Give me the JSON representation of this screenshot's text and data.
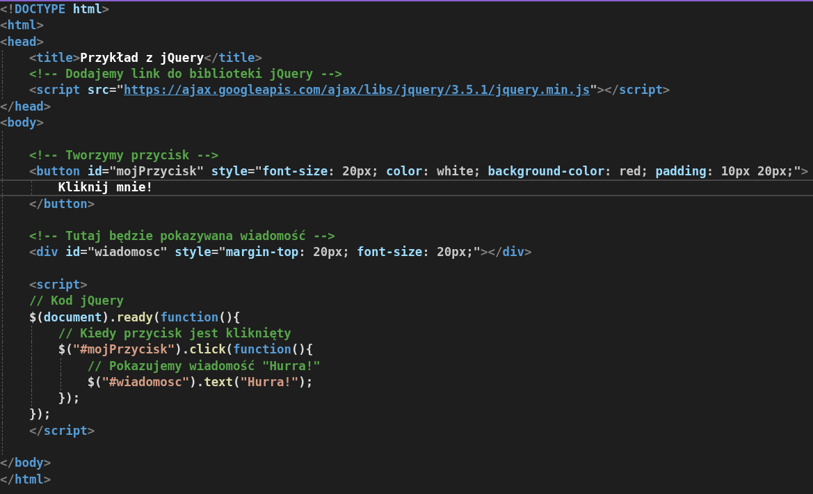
{
  "editor": {
    "lines": [
      {
        "current": false,
        "tokens": [
          {
            "text": "<!",
            "kind": "punct"
          },
          {
            "text": "DOCTYPE",
            "kind": "tag"
          },
          {
            "text": " html",
            "kind": "attr"
          },
          {
            "text": ">",
            "kind": "punct"
          }
        ]
      },
      {
        "current": false,
        "tokens": [
          {
            "text": "<",
            "kind": "punct"
          },
          {
            "text": "html",
            "kind": "tag"
          },
          {
            "text": ">",
            "kind": "punct"
          }
        ]
      },
      {
        "current": false,
        "tokens": [
          {
            "text": "<",
            "kind": "punct"
          },
          {
            "text": "head",
            "kind": "tag"
          },
          {
            "text": ">",
            "kind": "punct"
          }
        ]
      },
      {
        "current": false,
        "tokens": [
          {
            "text": "    <",
            "kind": "punct"
          },
          {
            "text": "title",
            "kind": "tag"
          },
          {
            "text": ">",
            "kind": "punct"
          },
          {
            "text": "Przykład z jQuery",
            "kind": "text"
          },
          {
            "text": "</",
            "kind": "punct"
          },
          {
            "text": "title",
            "kind": "tag"
          },
          {
            "text": ">",
            "kind": "punct"
          }
        ]
      },
      {
        "current": false,
        "tokens": [
          {
            "text": "    <!-- Dodajemy link do biblioteki jQuery -->",
            "kind": "comment"
          }
        ]
      },
      {
        "current": false,
        "tokens": [
          {
            "text": "    <",
            "kind": "punct"
          },
          {
            "text": "script",
            "kind": "tag"
          },
          {
            "text": " src",
            "kind": "attr"
          },
          {
            "text": "=\"",
            "kind": "value"
          },
          {
            "text": "https://ajax.googleapis.com/ajax/libs/jquery/3.5.1/jquery.min.js",
            "kind": "link"
          },
          {
            "text": "\"",
            "kind": "value"
          },
          {
            "text": "></",
            "kind": "punct"
          },
          {
            "text": "script",
            "kind": "tag"
          },
          {
            "text": ">",
            "kind": "punct"
          }
        ]
      },
      {
        "current": false,
        "tokens": [
          {
            "text": "</",
            "kind": "punct"
          },
          {
            "text": "head",
            "kind": "tag"
          },
          {
            "text": ">",
            "kind": "punct"
          }
        ]
      },
      {
        "current": false,
        "tokens": [
          {
            "text": "<",
            "kind": "punct"
          },
          {
            "text": "body",
            "kind": "tag"
          },
          {
            "text": ">",
            "kind": "punct"
          }
        ]
      },
      {
        "current": false
      },
      {
        "current": false,
        "tokens": [
          {
            "text": "    <!-- Tworzymy przycisk -->",
            "kind": "comment"
          }
        ]
      },
      {
        "current": false,
        "tokens": [
          {
            "text": "    <",
            "kind": "punct"
          },
          {
            "text": "button",
            "kind": "tag"
          },
          {
            "text": " id",
            "kind": "attr"
          },
          {
            "text": "=\"mojPrzycisk\"",
            "kind": "value"
          },
          {
            "text": " style",
            "kind": "attr"
          },
          {
            "text": "=\"",
            "kind": "value"
          },
          {
            "text": "font-size",
            "kind": "cssprop"
          },
          {
            "text": ": 20px; ",
            "kind": "value"
          },
          {
            "text": "color",
            "kind": "cssprop"
          },
          {
            "text": ": white; ",
            "kind": "value"
          },
          {
            "text": "background-color",
            "kind": "cssprop"
          },
          {
            "text": ": red; ",
            "kind": "value"
          },
          {
            "text": "padding",
            "kind": "cssprop"
          },
          {
            "text": ": 10px 20px;\"",
            "kind": "value"
          },
          {
            "text": ">",
            "kind": "punct"
          }
        ]
      },
      {
        "current": true,
        "tokens": [
          {
            "text": "        Kliknij mnie!",
            "kind": "text"
          }
        ]
      },
      {
        "current": false,
        "tokens": [
          {
            "text": "    </",
            "kind": "punct"
          },
          {
            "text": "button",
            "kind": "tag"
          },
          {
            "text": ">",
            "kind": "punct"
          }
        ]
      },
      {
        "current": false
      },
      {
        "current": false,
        "tokens": [
          {
            "text": "    <!-- Tutaj będzie pokazywana wiadomość -->",
            "kind": "comment"
          }
        ]
      },
      {
        "current": false,
        "tokens": [
          {
            "text": "    <",
            "kind": "punct"
          },
          {
            "text": "div",
            "kind": "tag"
          },
          {
            "text": " id",
            "kind": "attr"
          },
          {
            "text": "=\"wiadomosc\"",
            "kind": "value"
          },
          {
            "text": " style",
            "kind": "attr"
          },
          {
            "text": "=\"",
            "kind": "value"
          },
          {
            "text": "margin-top",
            "kind": "cssprop"
          },
          {
            "text": ": 20px; ",
            "kind": "value"
          },
          {
            "text": "font-size",
            "kind": "cssprop"
          },
          {
            "text": ": 20px;\"",
            "kind": "value"
          },
          {
            "text": "></",
            "kind": "punct"
          },
          {
            "text": "div",
            "kind": "tag"
          },
          {
            "text": ">",
            "kind": "punct"
          }
        ]
      },
      {
        "current": false
      },
      {
        "current": false,
        "tokens": [
          {
            "text": "    <",
            "kind": "punct"
          },
          {
            "text": "script",
            "kind": "tag"
          },
          {
            "text": ">",
            "kind": "punct"
          }
        ]
      },
      {
        "current": false,
        "tokens": [
          {
            "text": "    // Kod jQuery",
            "kind": "comment"
          }
        ]
      },
      {
        "current": false,
        "tokens": [
          {
            "text": "    $(",
            "kind": "plain"
          },
          {
            "text": "document",
            "kind": "ident"
          },
          {
            "text": ").",
            "kind": "plain"
          },
          {
            "text": "ready",
            "kind": "func"
          },
          {
            "text": "(",
            "kind": "plain"
          },
          {
            "text": "function",
            "kind": "keyword"
          },
          {
            "text": "(){",
            "kind": "plain"
          }
        ]
      },
      {
        "current": false,
        "tokens": [
          {
            "text": "        // Kiedy przycisk jest kliknięty",
            "kind": "comment"
          }
        ]
      },
      {
        "current": false,
        "tokens": [
          {
            "text": "        $(",
            "kind": "plain"
          },
          {
            "text": "\"#mojPrzycisk\"",
            "kind": "str"
          },
          {
            "text": ").",
            "kind": "plain"
          },
          {
            "text": "click",
            "kind": "func"
          },
          {
            "text": "(",
            "kind": "plain"
          },
          {
            "text": "function",
            "kind": "keyword"
          },
          {
            "text": "(){",
            "kind": "plain"
          }
        ]
      },
      {
        "current": false,
        "tokens": [
          {
            "text": "            // Pokazujemy wiadomość \"Hurra!\"",
            "kind": "comment"
          }
        ]
      },
      {
        "current": false,
        "tokens": [
          {
            "text": "            $(",
            "kind": "plain"
          },
          {
            "text": "\"#wiadomosc\"",
            "kind": "str"
          },
          {
            "text": ").",
            "kind": "plain"
          },
          {
            "text": "text",
            "kind": "func"
          },
          {
            "text": "(",
            "kind": "plain"
          },
          {
            "text": "\"Hurra!\"",
            "kind": "str"
          },
          {
            "text": ");",
            "kind": "plain"
          }
        ]
      },
      {
        "current": false,
        "tokens": [
          {
            "text": "        });",
            "kind": "plain"
          }
        ]
      },
      {
        "current": false,
        "tokens": [
          {
            "text": "    });",
            "kind": "plain"
          }
        ]
      },
      {
        "current": false,
        "tokens": [
          {
            "text": "    </",
            "kind": "punct"
          },
          {
            "text": "script",
            "kind": "tag"
          },
          {
            "text": ">",
            "kind": "punct"
          }
        ]
      },
      {
        "current": false
      },
      {
        "current": false,
        "tokens": [
          {
            "text": "</",
            "kind": "punct"
          },
          {
            "text": "body",
            "kind": "tag"
          },
          {
            "text": ">",
            "kind": "punct"
          }
        ]
      },
      {
        "current": false,
        "tokens": [
          {
            "text": "</",
            "kind": "punct"
          },
          {
            "text": "html",
            "kind": "tag"
          },
          {
            "text": ">",
            "kind": "punct"
          }
        ]
      }
    ]
  }
}
